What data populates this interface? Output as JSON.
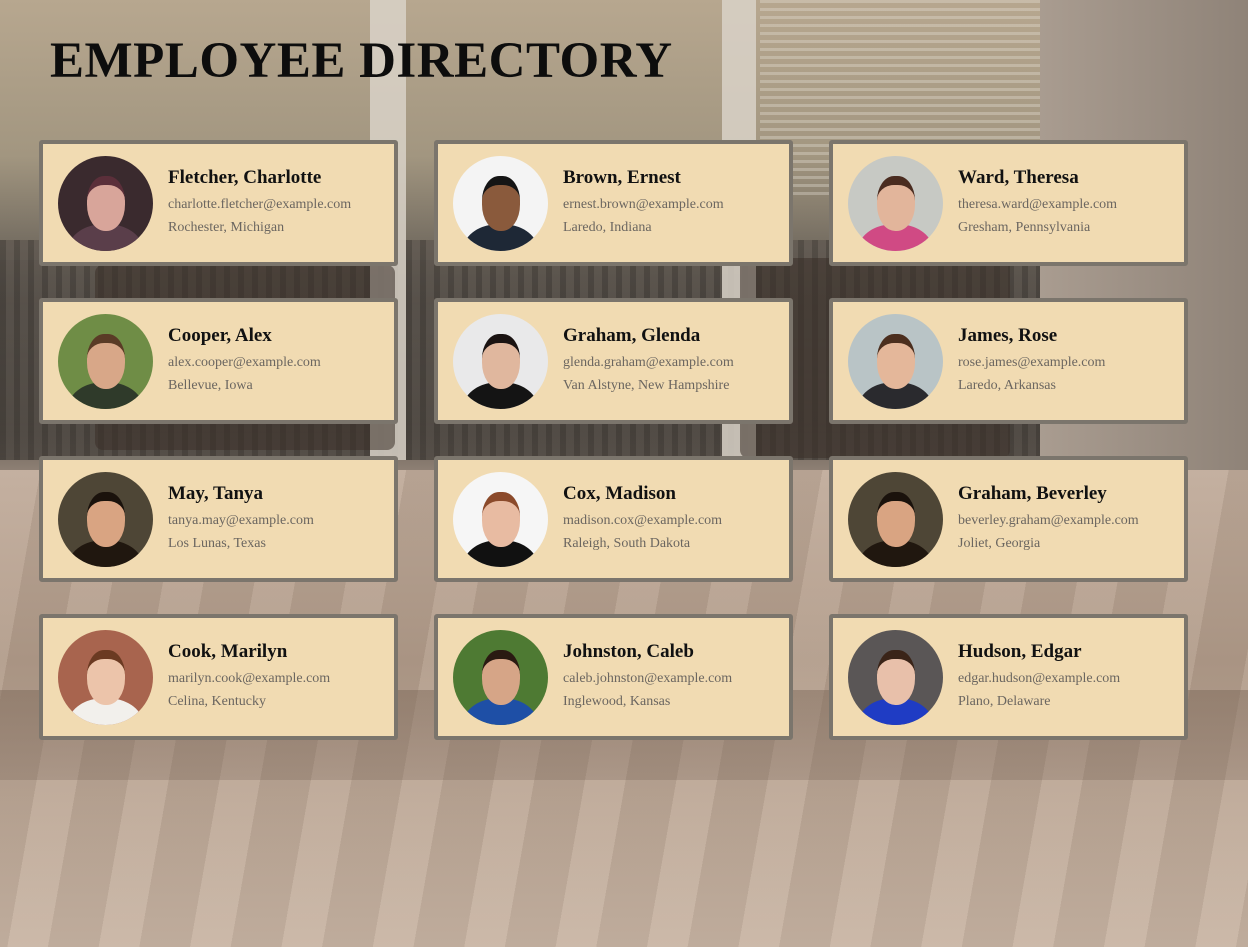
{
  "page": {
    "title": "EMPLOYEE DIRECTORY"
  },
  "employees": [
    {
      "name": "Fletcher, Charlotte",
      "email": "charlotte.fletcher@example.com",
      "location": "Rochester, Michigan",
      "avatar": {
        "bg": "#3a2a2e",
        "face": "#d8a59a",
        "body": "#5a3e4a",
        "hair": "#5b2f3a"
      }
    },
    {
      "name": "Brown, Ernest",
      "email": "ernest.brown@example.com",
      "location": "Laredo, Indiana",
      "avatar": {
        "bg": "#f4f4f4",
        "face": "#8a5a3c",
        "body": "#1e2836",
        "hair": "#151515"
      }
    },
    {
      "name": "Ward, Theresa",
      "email": "theresa.ward@example.com",
      "location": "Gresham, Pennsylvania",
      "avatar": {
        "bg": "#c7c9c4",
        "face": "#e2b59b",
        "body": "#d04a84",
        "hair": "#4a2c20"
      }
    },
    {
      "name": "Cooper, Alex",
      "email": "alex.cooper@example.com",
      "location": "Bellevue, Iowa",
      "avatar": {
        "bg": "#6f8d46",
        "face": "#d8a788",
        "body": "#2f3a2a",
        "hair": "#5a3b26"
      }
    },
    {
      "name": "Graham, Glenda",
      "email": "glenda.graham@example.com",
      "location": "Van Alstyne, New Hampshire",
      "avatar": {
        "bg": "#e9e9ea",
        "face": "#e0b79e",
        "body": "#141414",
        "hair": "#1a1312"
      }
    },
    {
      "name": "James, Rose",
      "email": "rose.james@example.com",
      "location": "Laredo, Arkansas",
      "avatar": {
        "bg": "#b9c4c6",
        "face": "#e4b79a",
        "body": "#2a2a2e",
        "hair": "#4b2e1e"
      }
    },
    {
      "name": "May, Tanya",
      "email": "tanya.may@example.com",
      "location": "Los Lunas, Texas",
      "avatar": {
        "bg": "#4e4636",
        "face": "#d9a482",
        "body": "#20170f",
        "hair": "#1a120c"
      }
    },
    {
      "name": "Cox, Madison",
      "email": "madison.cox@example.com",
      "location": "Raleigh, South Dakota",
      "avatar": {
        "bg": "#f6f6f6",
        "face": "#e8bba2",
        "body": "#111111",
        "hair": "#8b4a2b"
      }
    },
    {
      "name": "Graham, Beverley",
      "email": "beverley.graham@example.com",
      "location": "Joliet, Georgia",
      "avatar": {
        "bg": "#4e4636",
        "face": "#d9a482",
        "body": "#20170f",
        "hair": "#1a120c"
      }
    },
    {
      "name": "Cook, Marilyn",
      "email": "marilyn.cook@example.com",
      "location": "Celina, Kentucky",
      "avatar": {
        "bg": "#a8644e",
        "face": "#ecc4aa",
        "body": "#f2f0ec",
        "hair": "#6b3a22"
      }
    },
    {
      "name": "Johnston, Caleb",
      "email": "caleb.johnston@example.com",
      "location": "Inglewood, Kansas",
      "avatar": {
        "bg": "#4e7a33",
        "face": "#d6a587",
        "body": "#1e4fa6",
        "hair": "#2a1a12"
      }
    },
    {
      "name": "Hudson, Edgar",
      "email": "edgar.hudson@example.com",
      "location": "Plano, Delaware",
      "avatar": {
        "bg": "#5a5656",
        "face": "#e8c0aa",
        "body": "#1f3cc4",
        "hair": "#3a2418"
      }
    }
  ]
}
